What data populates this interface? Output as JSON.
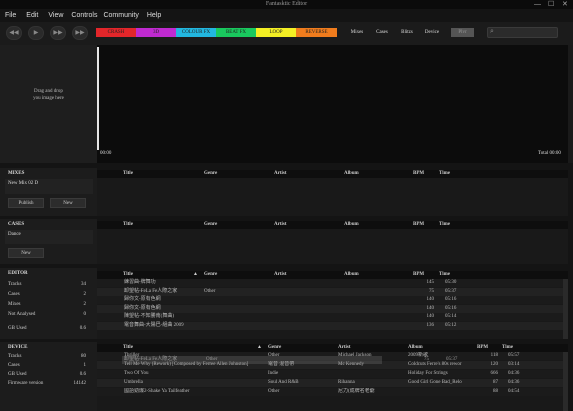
{
  "window": {
    "title": "Fantasktic Editor",
    "min": "—",
    "max": "☐",
    "close": "✕"
  },
  "menu": [
    "File",
    "Edit",
    "View",
    "Controls",
    "Community",
    "Help"
  ],
  "fx": [
    {
      "label": "CRASH",
      "color": "#e3262a"
    },
    {
      "label": "3D",
      "color": "#c02ad0"
    },
    {
      "label": "COLOUR FX",
      "color": "#22b7e0"
    },
    {
      "label": "BEAT FX",
      "color": "#19c95e"
    },
    {
      "label": "LOOP",
      "color": "#f4ef24"
    },
    {
      "label": "REVERSE",
      "color": "#f07c1d"
    }
  ],
  "segments": [
    "Mixes",
    "Cases",
    "Blitzs",
    "Device"
  ],
  "file_button": "Plvr",
  "drop": {
    "line1": "Drag and drop",
    "line2": "you image here"
  },
  "time": {
    "start": "00:00",
    "total": "Total 00:00"
  },
  "mixes": {
    "title": "MIXES",
    "item": "New Mix 02 D",
    "publish": "Publish",
    "new": "New"
  },
  "cases": {
    "title": "CASES",
    "item": "Dance",
    "new": "New"
  },
  "headers": {
    "title": "Title",
    "genre": "Genre",
    "artist": "Artist",
    "album": "Album",
    "bpm": "BPM",
    "time": "Time"
  },
  "editor": {
    "title": "EDITOR",
    "stats": [
      {
        "label": "Tracks",
        "value": "34"
      },
      {
        "label": "Cases",
        "value": "2"
      },
      {
        "label": "Mixes",
        "value": "2"
      },
      {
        "label": "Not Analysed",
        "value": "0"
      },
      {
        "label": "GB Used",
        "value": "0.6"
      }
    ],
    "rows": [
      {
        "title": "練習曲-牌舞功",
        "genre": "",
        "bpm": "145",
        "time": "05:30"
      },
      {
        "title": "卸望帖-FeLa Fe人際之家",
        "genre": "Other",
        "bpm": "75",
        "time": "05:37"
      },
      {
        "title": "歸你文-原有色網",
        "genre": "",
        "bpm": "140",
        "time": "05:16"
      },
      {
        "title": "歸你文-原有色網",
        "genre": "",
        "bpm": "140",
        "time": "05:16"
      },
      {
        "title": "陳望帖-不知勝南(舞曲)",
        "genre": "",
        "bpm": "140",
        "time": "05:14"
      },
      {
        "title": "電音舞曲-大陽巴-組曲 2009",
        "genre": "",
        "bpm": "136",
        "time": "05:12"
      }
    ]
  },
  "device": {
    "title": "DEVICE",
    "stats": [
      {
        "label": "Tracks",
        "value": "80"
      },
      {
        "label": "Cases",
        "value": "1"
      },
      {
        "label": "GB Used",
        "value": "0.6"
      },
      {
        "label": "Firmware version",
        "value": "14142"
      }
    ],
    "rows": [
      {
        "title": "Thriller",
        "genre": "Other",
        "artist": "Michael Jackson",
        "album": "2009新歌",
        "bpm": "118",
        "time": "05:57"
      },
      {
        "title": "Tell Me Why (Rework) [Composed by Ferree Allen Johnston]",
        "genre": "電音 混音帶",
        "artist": "Mc Kennedy",
        "album": "Coldcuts Ferre's 80s rewor",
        "bpm": "120",
        "time": "03:14"
      },
      {
        "title": "Two Of You",
        "genre": "Indie",
        "artist": "",
        "album": "Holiday For Strings",
        "bpm": "666",
        "time": "04:36"
      },
      {
        "title": "Umbrella",
        "genre": "Soul And R&B",
        "artist": "Rihanna",
        "album": "Good Girl Gone Bad_Relo",
        "bpm": "87",
        "time": "04:36"
      },
      {
        "title": "國語勁爆2-Shake Ya Tailfeather",
        "genre": "Other",
        "artist": "尼力(成牌名老爺",
        "album": "",
        "bpm": "88",
        "time": "04:54"
      }
    ],
    "drag": {
      "title": "卸望帖-FeLa Fe人際之家",
      "genre": "Other",
      "bpm": "75",
      "time": "05:37"
    }
  }
}
